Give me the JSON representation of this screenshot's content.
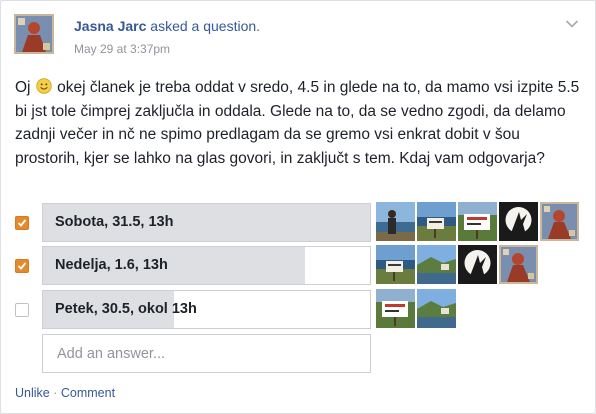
{
  "post": {
    "author": "Jasna Jarc",
    "action": "asked a question.",
    "timestamp": "May 29 at 3:37pm",
    "text_before_emoji": "Oj",
    "text_after_emoji": "okej članek je treba oddat v sredo, 4.5 in glede na to, da mamo vsi izpite 5.5 bi jst tole čimprej zaključla in oddala. Glede na to, da se vedno zgodi, da delamo zadnji večer in nč ne spimo predlagam da se gremo vsi enkrat dobit v šou prostorih, kjer se lahko na glas govori, in zaključt s tem. Kdaj vam odgovarja?",
    "emoji_icon": "smiley-icon",
    "menu_icon": "chevron-down-icon"
  },
  "poll": {
    "options": [
      {
        "label": "Sobota, 31.5, 13h",
        "checked": true,
        "fill_fraction": 1.0,
        "voters": [
          "photo-person-coast",
          "photo-coast-sign",
          "photo-sign-field",
          "photo-moon-silhouette",
          "photo-profile-art"
        ]
      },
      {
        "label": "Nedelja, 1.6, 13h",
        "checked": true,
        "fill_fraction": 0.8,
        "voters": [
          "photo-coast-sign",
          "photo-coast-landscape",
          "photo-moon-silhouette",
          "photo-profile-art"
        ]
      },
      {
        "label": "Petek, 30.5, okol 13h",
        "checked": false,
        "fill_fraction": 0.4,
        "voters": [
          "photo-sign-field",
          "photo-coast-landscape"
        ]
      }
    ],
    "add_answer_placeholder": "Add an answer..."
  },
  "footer": {
    "unlike": "Unlike",
    "separator": " · ",
    "comment": "Comment"
  },
  "colors": {
    "link": "#365899",
    "checkbox_checked": "#e38b2c",
    "bar_fill": "#dddfe2"
  }
}
